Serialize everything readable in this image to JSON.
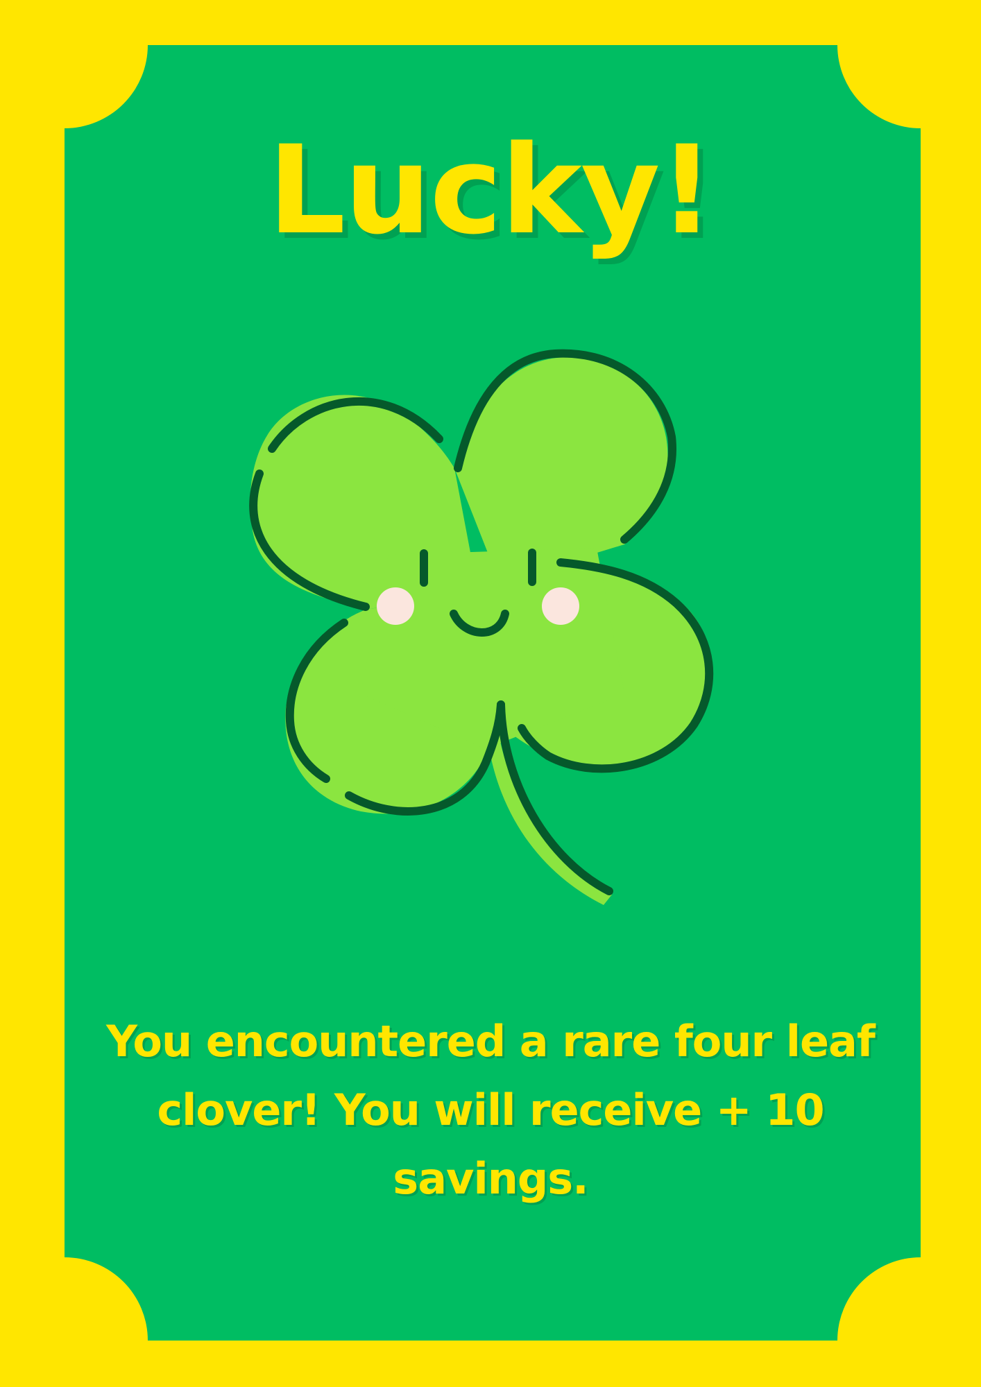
{
  "card": {
    "title": "Lucky!",
    "message": "You encountered a rare four leaf clover! You will receive + 10 savings.",
    "illustration_icon": "four-leaf-clover-icon"
  },
  "colors": {
    "border_yellow": "#FFE600",
    "card_green": "#00BD62",
    "title_shadow": "#00A152",
    "leaf_light": "#8BE540",
    "leaf_outline": "#05592B",
    "cheek": "#FBE6DE"
  }
}
